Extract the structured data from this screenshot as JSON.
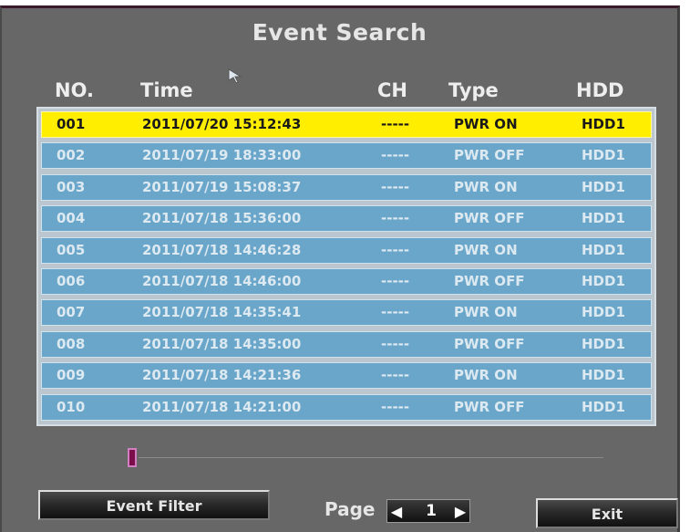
{
  "title": "Event Search",
  "headers": {
    "no": "NO.",
    "time": "Time",
    "ch": "CH",
    "type": "Type",
    "hdd": "HDD"
  },
  "events": [
    {
      "no": "001",
      "time": "2011/07/20 15:12:43",
      "ch": "-----",
      "type": "PWR ON",
      "hdd": "HDD1",
      "selected": true
    },
    {
      "no": "002",
      "time": "2011/07/19 18:33:00",
      "ch": "-----",
      "type": "PWR OFF",
      "hdd": "HDD1"
    },
    {
      "no": "003",
      "time": "2011/07/19 15:08:37",
      "ch": "-----",
      "type": "PWR ON",
      "hdd": "HDD1"
    },
    {
      "no": "004",
      "time": "2011/07/18 15:36:00",
      "ch": "-----",
      "type": "PWR OFF",
      "hdd": "HDD1"
    },
    {
      "no": "005",
      "time": "2011/07/18 14:46:28",
      "ch": "-----",
      "type": "PWR ON",
      "hdd": "HDD1"
    },
    {
      "no": "006",
      "time": "2011/07/18 14:46:00",
      "ch": "-----",
      "type": "PWR OFF",
      "hdd": "HDD1"
    },
    {
      "no": "007",
      "time": "2011/07/18 14:35:41",
      "ch": "-----",
      "type": "PWR ON",
      "hdd": "HDD1"
    },
    {
      "no": "008",
      "time": "2011/07/18 14:35:00",
      "ch": "-----",
      "type": "PWR OFF",
      "hdd": "HDD1"
    },
    {
      "no": "009",
      "time": "2011/07/18 14:21:36",
      "ch": "-----",
      "type": "PWR ON",
      "hdd": "HDD1"
    },
    {
      "no": "010",
      "time": "2011/07/18 14:21:00",
      "ch": "-----",
      "type": "PWR OFF",
      "hdd": "HDD1"
    }
  ],
  "footer": {
    "event_filter_label": "Event Filter",
    "page_label": "Page",
    "page_number": "1",
    "exit_label": "Exit"
  },
  "colors": {
    "selected_row": "#ffee00",
    "row": "#6aa6c9",
    "background": "#676767"
  }
}
